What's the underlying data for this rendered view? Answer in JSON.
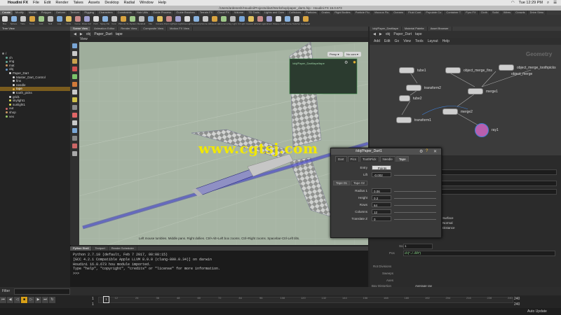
{
  "menubar": {
    "app_name": "Houdini FX",
    "items": [
      "File",
      "Edit",
      "Render",
      "Takes",
      "Assets",
      "Desktop",
      "Radial",
      "Window",
      "Help"
    ],
    "clock": "Tue 12:29 PM"
  },
  "window_title": "/Users/ardenesh/Houdini/Projects/dart/Workshop/paper_dart1.hip - Houdini FX 16.0.673",
  "shelf_tabs": [
    "Create",
    "Modify",
    "Model",
    "Polygon",
    "Deform",
    "Texture",
    "Rigging",
    "Characters",
    "Constraints",
    "Hair Utils",
    "Guide Process",
    "Guide Brushes",
    "Terrain FX",
    "Cloud FX",
    "Volume",
    "TD Tools",
    "Lights and Cam",
    "Collisions",
    "Particles",
    "Grains",
    "Rigid Bodies",
    "Particle Flu",
    "Viscous Flu",
    "Oceans",
    "Fluid Cont",
    "Populate Co",
    "Container T",
    "Pyro FX",
    "Cloth",
    "Solid",
    "Wires",
    "Crowds",
    "Drive Simu"
  ],
  "shelf_tools": [
    "Box",
    "Sphere",
    "Tube",
    "Torus",
    "Grid",
    "Null",
    "Line",
    "Circle",
    "Curve",
    "Draw Curve",
    "Path",
    "Spray Paint",
    "Font",
    "Platonic Solids",
    "L-System",
    "Metaball",
    "File",
    "Camera",
    "Point Light",
    "Spot Light",
    "Area Light",
    "Geometry Light",
    "Volume Light",
    "Distant Light",
    "Environment Light",
    "Sky Light",
    "GI Light",
    "Caustic Light",
    "Portal Light",
    "Ambient Light",
    "Stereo Camera",
    "VR Camera",
    "Switcher",
    "Gamepad Camera"
  ],
  "tree": {
    "tabs": [
      "Tree View"
    ],
    "rows": [
      {
        "label": "/",
        "indent": 0,
        "color": "#888"
      },
      {
        "label": "ch",
        "indent": 1,
        "color": "#6a9"
      },
      {
        "label": "img",
        "indent": 1,
        "color": "#6a9"
      },
      {
        "label": "mat",
        "indent": 1,
        "color": "#c96"
      },
      {
        "label": "obj",
        "indent": 1,
        "color": "#69c"
      },
      {
        "label": "Paper_Dart",
        "indent": 2,
        "color": "#ddd"
      },
      {
        "label": "Master_Dart_Control",
        "indent": 3,
        "color": "#ddd"
      },
      {
        "label": "fins",
        "indent": 3,
        "color": "#ddd"
      },
      {
        "label": "needle",
        "indent": 3,
        "color": "#ddd"
      },
      {
        "label": "tape",
        "indent": 3,
        "color": "#e8b23a",
        "selected": true
      },
      {
        "label": "tooth_picks",
        "indent": 3,
        "color": "#ddd"
      },
      {
        "label": "grid1",
        "indent": 2,
        "color": "#ddd"
      },
      {
        "label": "skylight1",
        "indent": 2,
        "color": "#dd5"
      },
      {
        "label": "sunlight1",
        "indent": 2,
        "color": "#dd5"
      },
      {
        "label": "out",
        "indent": 1,
        "color": "#c66"
      },
      {
        "label": "shop",
        "indent": 1,
        "color": "#c96"
      },
      {
        "label": "vex",
        "indent": 1,
        "color": "#9c6"
      }
    ]
  },
  "viewport": {
    "tabs": [
      "Scene View",
      "Animation Editor",
      "Render View",
      "Composite View",
      "Motion FX View"
    ],
    "path": [
      "obj",
      "Paper_Dart",
      "tape"
    ],
    "label": "View",
    "cam_btns": [
      "Persp ▾",
      "No cam ▾"
    ],
    "inset_label": "/obj/Paper_Dart/tape/tape",
    "help": "Left mouse tumbles. Middle pans. Right dollies. Ctrl+Alt+Left box zooms. Ctrl+Right zooms. Spacebar-Ctrl-Left tilts."
  },
  "network": {
    "tabs": [
      "/obj/Paper_Dart/tape",
      "Material Palette",
      "Asset Browser"
    ],
    "path": [
      "obj",
      "Paper_Dart",
      "tape"
    ],
    "menu": [
      "Add",
      "Edit",
      "Go",
      "View",
      "Tools",
      "Layout",
      "Help"
    ],
    "context_label": "Geometry",
    "nodes": {
      "tube1": "tube1",
      "object_merge_fins": "object_merge_fins",
      "object_merge_toothpicks": "object_merge_toothpicks",
      "object_merge": "object_merge",
      "transform2": "transform2",
      "merge1": "merge1",
      "tube2": "tube2",
      "merge2": "merge2",
      "transform1": "transform1",
      "ray1": "ray1"
    }
  },
  "float_window": {
    "title": "/obj/Paper_Dart1",
    "tabs": [
      "Dart",
      "Pics",
      "ToothPick",
      "Needle",
      "Tape"
    ],
    "entry_label": "Entry",
    "entry_value": "Points",
    "lift_label": "Lift",
    "lift_value": "-0.002",
    "subtabs": [
      "Tape 01",
      "Tape 02"
    ],
    "fields": [
      {
        "label": "Radius 1",
        "value": "0.06"
      },
      {
        "label": "Height",
        "value": "0.2"
      },
      {
        "label": "Rows",
        "value": "64"
      },
      {
        "label": "Columns",
        "value": "12"
      },
      {
        "label": "Translate Z",
        "value": "0"
      }
    ]
  },
  "params": {
    "labels": [
      "Scale",
      "Pos",
      "Rot Divisions",
      "Sweeps",
      "Axes",
      "Bay Distortion",
      "Alter Scale"
    ],
    "scale_value": "1",
    "expr_value": "ch(\"../../lift\")",
    "checks": [
      "Surface",
      "Normal",
      "Distance"
    ],
    "dropdown": "Average ray"
  },
  "bottom": {
    "tabs": [
      "Python Shell",
      "Textport",
      "Render Scheduler"
    ],
    "console_lines": [
      "Python 2.7.10 (default, Feb  7 2017, 00:08:15)",
      "[GCC 4.2.1 Compatible Apple LLVM 8.0.0 (clang-800.0.34)] on darwin",
      "Houdini 16.0.673 hou module imported.",
      "Type \"help\", \"copyright\", \"credits\" or \"license\" for more information.",
      ">>>"
    ]
  },
  "timeline": {
    "filter_label": "Filter",
    "frame_start": "1",
    "frame_current": "1",
    "frame_end": "240",
    "ticks": [
      "12",
      "24",
      "36",
      "48",
      "60",
      "72",
      "84",
      "96",
      "108",
      "120",
      "132",
      "144",
      "156",
      "168",
      "180",
      "192",
      "204",
      "216",
      "228",
      "240"
    ],
    "update_mode": "Auto Update"
  },
  "watermark": "www.cgtsj.com"
}
